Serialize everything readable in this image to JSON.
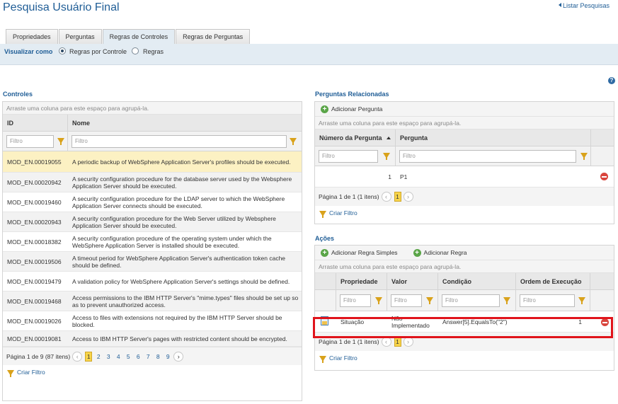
{
  "page": {
    "title": "Pesquisa Usuário Final",
    "list_link": "Listar Pesquisas"
  },
  "tabs": [
    {
      "label": "Propriedades",
      "active": false
    },
    {
      "label": "Perguntas",
      "active": false
    },
    {
      "label": "Regras de Controles",
      "active": true
    },
    {
      "label": "Regras de Perguntas",
      "active": false
    }
  ],
  "view_as": {
    "label": "Visualizar como",
    "options": [
      {
        "label": "Regras por Controle",
        "selected": true
      },
      {
        "label": "Regras",
        "selected": false
      }
    ]
  },
  "controls": {
    "section_title": "Controles",
    "group_hint": "Arraste uma coluna para este espaço para agrupá-la.",
    "columns": [
      "ID",
      "Nome"
    ],
    "filter_placeholder": "Filtro",
    "rows": [
      {
        "id": "MOD_EN.00019055",
        "name": "A periodic backup of WebSphere Application Server's profiles should be executed."
      },
      {
        "id": "MOD_EN.00020942",
        "name": "A security configuration procedure for the database server used by the Websphere Application Server should be executed."
      },
      {
        "id": "MOD_EN.00019460",
        "name": "A security configuration procedure for the LDAP server to which the WebSphere Application Server connects should be executed."
      },
      {
        "id": "MOD_EN.00020943",
        "name": "A security configuration procedure for the Web Server utilized by Websphere Application Server should be executed."
      },
      {
        "id": "MOD_EN.00018382",
        "name": "A security configuration procedure of the operating system under which the WebSphere Application Server is installed should be executed."
      },
      {
        "id": "MOD_EN.00019506",
        "name": "A timeout period for WebSphere Application Server's authentication token cache should be defined."
      },
      {
        "id": "MOD_EN.00019479",
        "name": "A validation policy for WebSphere Application Server's settings should be defined."
      },
      {
        "id": "MOD_EN.00019468",
        "name": "Access permissions to the IBM HTTP Server's \"mime.types\" files should be set up so as to prevent unauthorized access."
      },
      {
        "id": "MOD_EN.00019026",
        "name": "Access to files with extensions not required by the IBM HTTP Server should be blocked."
      },
      {
        "id": "MOD_EN.00019081",
        "name": "Access to IBM HTTP Server's pages with restricted content should be encrypted."
      }
    ],
    "pager_text": "Página 1 de 9 (87 itens)",
    "pages": [
      "1",
      "2",
      "3",
      "4",
      "5",
      "6",
      "7",
      "8",
      "9"
    ],
    "create_filter": "Criar Filtro"
  },
  "questions": {
    "section_title": "Perguntas Relacionadas",
    "add_button": "Adicionar Pergunta",
    "group_hint": "Arraste uma coluna para este espaço para agrupá-la.",
    "columns": [
      "Número da Pergunta",
      "Pergunta"
    ],
    "filter_placeholder": "Filtro",
    "rows": [
      {
        "number": "1",
        "question": "P1"
      }
    ],
    "pager_text": "Página 1 de 1 (1 itens)",
    "pages": [
      "1"
    ],
    "create_filter": "Criar Filtro"
  },
  "actions": {
    "section_title": "Ações",
    "add_simple_rule": "Adicionar Regra Simples",
    "add_rule": "Adicionar Regra",
    "group_hint": "Arraste uma coluna para este espaço para agrupá-la.",
    "columns": [
      "Propriedade",
      "Valor",
      "Condição",
      "Ordem de Execução"
    ],
    "filter_placeholder": "Filtro",
    "rows": [
      {
        "property": "Situação",
        "value_line1": "Não",
        "value_line2": "Implementado",
        "condition": "Answer[5].EqualsTo(\"2\")",
        "order": "1"
      }
    ],
    "pager_text": "Página 1 de 1 (1 itens)",
    "pages": [
      "1"
    ],
    "create_filter": "Criar Filtro"
  },
  "colors": {
    "title": "#1f5d96",
    "selected_row": "#fcf1c3",
    "highlight": "#e0141b",
    "view_bar": "#e3ecf3"
  }
}
